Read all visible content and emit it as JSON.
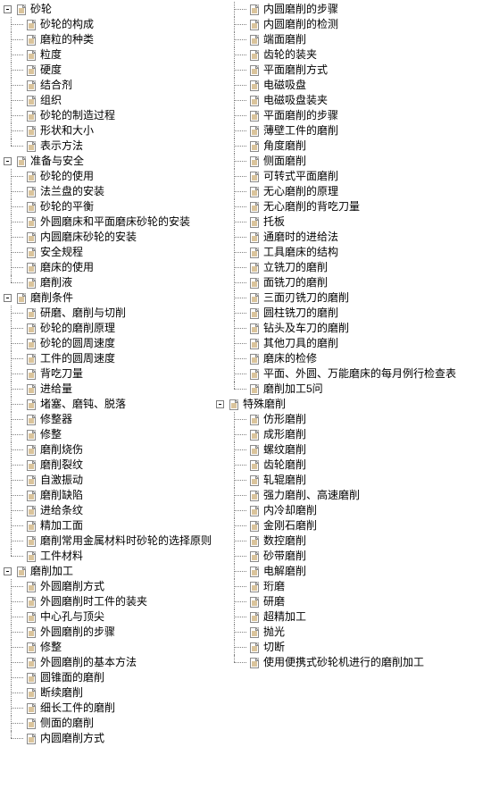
{
  "sections_left": [
    {
      "title": "砂轮",
      "items": [
        "砂轮的构成",
        "磨粒的种类",
        "粒度",
        "硬度",
        "结合剂",
        "组织",
        "砂轮的制造过程",
        "形状和大小",
        "表示方法"
      ]
    },
    {
      "title": "准备与安全",
      "items": [
        "砂轮的使用",
        "法兰盘的安装",
        "砂轮的平衡",
        "外圆磨床和平面磨床砂轮的安装",
        "内圆磨床砂轮的安装",
        "安全规程",
        "磨床的使用",
        "磨削液"
      ]
    },
    {
      "title": "磨削条件",
      "items": [
        "研磨、磨削与切削",
        "砂轮的磨削原理",
        "砂轮的圆周速度",
        "工件的圆周速度",
        "背吃刀量",
        "进给量",
        "堵塞、磨钝、脱落",
        "修整器",
        "修整",
        "磨削烧伤",
        "磨削裂纹",
        "自激振动",
        "磨削缺陷",
        "进给条纹",
        "精加工面",
        "磨削常用金属材料时砂轮的选择原则",
        "工件材料"
      ]
    },
    {
      "title": "磨削加工",
      "items": [
        "外圆磨削方式",
        "外圆磨削时工件的装夹",
        "中心孔与顶尖",
        "外圆磨削的步骤",
        "修整",
        "外圆磨削的基本方法",
        "圆锥面的磨削",
        "断续磨削",
        "细长工件的磨削",
        "侧面的磨削",
        "内圆磨削方式"
      ]
    }
  ],
  "right_cont_items": [
    "内圆磨削的步骤",
    "内圆磨削的检测",
    "端面磨削",
    "齿轮的装夹",
    "平面磨削方式",
    "电磁吸盘",
    "电磁吸盘装夹",
    "平面磨削的步骤",
    "薄壁工件的磨削",
    "角度磨削",
    "侧面磨削",
    "可转式平面磨削",
    "无心磨削的原理",
    "无心磨削的背吃刀量",
    "托板",
    "通磨时的进给法",
    "工具磨床的结构",
    "立铣刀的磨削",
    "面铣刀的磨削",
    "三面刃铣刀的磨削",
    "圆柱铣刀的磨削",
    "钻头及车刀的磨削",
    "其他刀具的磨削",
    "磨床的检修",
    "平面、外圆、万能磨床的每月例行检查表",
    "磨削加工5问"
  ],
  "sections_right": [
    {
      "title": "特殊磨削",
      "items": [
        "仿形磨削",
        "成形磨削",
        "螺纹磨削",
        "齿轮磨削",
        "轧辊磨削",
        "强力磨削、高速磨削",
        "内冷却磨削",
        "金刚石磨削",
        "数控磨削",
        "砂带磨削",
        "电解磨削",
        "珩磨",
        "研磨",
        "超精加工",
        "抛光",
        "切断",
        "使用便携式砂轮机进行的磨削加工"
      ]
    }
  ],
  "chart_data": null
}
